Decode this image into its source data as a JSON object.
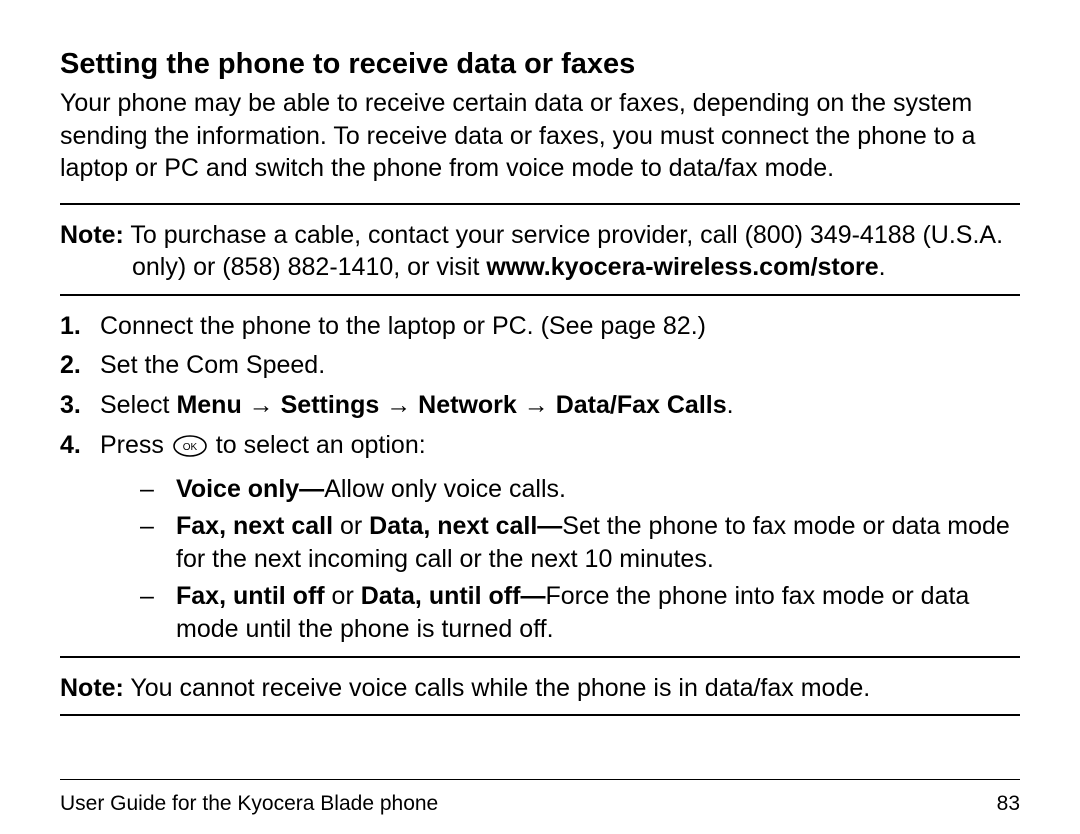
{
  "heading": "Setting the phone to receive data or faxes",
  "intro": "Your phone may be able to receive certain data or faxes, depending on the system sending the information. To receive data or faxes, you must connect the phone to a laptop or PC and switch the phone from voice mode to data/fax mode.",
  "note1": {
    "label": "Note:",
    "text_a": " To purchase a cable, contact your service provider, call (800) 349-4188 (U.S.A. only) or (858) 882-1410, or visit ",
    "url": "www.kyocera-wireless.com/store",
    "text_b": "."
  },
  "steps": {
    "s1": {
      "num": "1.",
      "text": "Connect the phone to the laptop or PC. (See page 82.)"
    },
    "s2": {
      "num": "2.",
      "text": "Set the Com Speed."
    },
    "s3": {
      "num": "3.",
      "prefix": "Select ",
      "p1": "Menu",
      "arrow": " → ",
      "p2": "Settings",
      "p3": "Network",
      "p4": "Data/Fax Calls",
      "suffix": "."
    },
    "s4": {
      "num": "4.",
      "prefix": "Press ",
      "suffix": " to select an option:"
    }
  },
  "options": {
    "o1": {
      "bold": "Voice only—",
      "text": "Allow only voice calls."
    },
    "o2": {
      "bold1": "Fax, next call",
      "mid": " or ",
      "bold2": "Data, next call—",
      "text": "Set the phone to fax mode or data mode for the next incoming call or the next 10 minutes."
    },
    "o3": {
      "bold1": "Fax, until off",
      "mid": " or ",
      "bold2": "Data, until off—",
      "text": "Force the phone into fax mode or data mode until the phone is turned off."
    }
  },
  "note2": {
    "label": "Note:",
    "text": " You cannot receive voice calls while the phone is in data/fax mode."
  },
  "footer": {
    "left": "User Guide for the Kyocera Blade phone",
    "right": "83"
  },
  "dash": "–"
}
